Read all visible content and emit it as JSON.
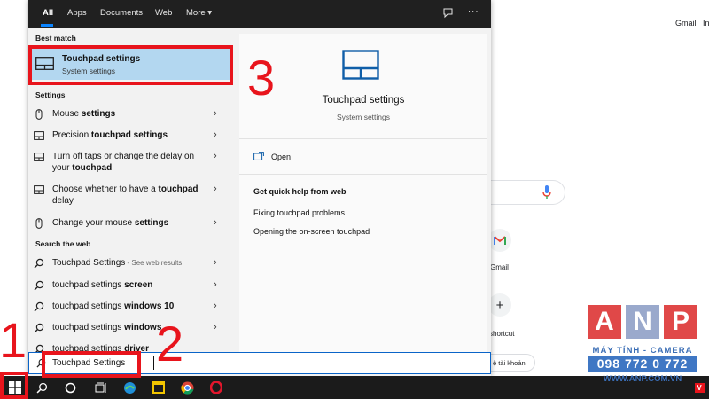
{
  "background": {
    "gmail": "Gmail",
    "images_partial": "In",
    "tile_gmail_label": "Gmail",
    "tile_add_label": "shortcut",
    "account_pill": "ệ tài khoản"
  },
  "search_panel": {
    "tabs": [
      {
        "label": "All",
        "active": true
      },
      {
        "label": "Apps",
        "active": false
      },
      {
        "label": "Documents",
        "active": false
      },
      {
        "label": "Web",
        "active": false
      },
      {
        "label": "More",
        "active": false
      }
    ],
    "more_caret": "▾",
    "feedback_icon": "feedback-icon",
    "overflow": "···",
    "best_match_header": "Best match",
    "best_match": {
      "title": "Touchpad settings",
      "subtitle": "System settings"
    },
    "settings_header": "Settings",
    "settings_items": [
      {
        "pre": "Mouse ",
        "bold": "settings",
        "post": ""
      },
      {
        "pre": "Precision ",
        "bold": "touchpad settings",
        "post": ""
      },
      {
        "pre": "Turn off taps or change the delay on your ",
        "bold": "touchpad",
        "post": ""
      },
      {
        "pre": "Choose whether to have a ",
        "bold": "touchpad",
        "post": " delay"
      },
      {
        "pre": "Change your mouse ",
        "bold": "settings",
        "post": ""
      }
    ],
    "web_header": "Search the web",
    "web_items": [
      {
        "pre": "Touchpad Settings",
        "bold": "",
        "muted": " - See web results"
      },
      {
        "pre": "touchpad settings ",
        "bold": "screen",
        "muted": ""
      },
      {
        "pre": "touchpad settings ",
        "bold": "windows 10",
        "muted": ""
      },
      {
        "pre": "touchpad settings ",
        "bold": "windows",
        "muted": ""
      },
      {
        "pre": "touchpad settings ",
        "bold": "driver",
        "muted": ""
      }
    ],
    "preview": {
      "title": "Touchpad settings",
      "subtitle": "System settings",
      "open_label": "Open",
      "help_header": "Get quick help from web",
      "help_links": [
        "Fixing touchpad problems",
        "Opening the on-screen touchpad"
      ]
    },
    "query": "Touchpad Settings"
  },
  "annotations": {
    "n1": "1",
    "n2": "2",
    "n3": "3",
    "color": "#e8141c"
  },
  "watermark": {
    "letters": [
      "A",
      "N",
      "P"
    ],
    "letter_colors": [
      "#e04848",
      "#9aa9cc",
      "#e04848"
    ],
    "line1": "MÁY TÍNH - CAMERA",
    "line2": "098 772 0 772",
    "line3": "WWW.ANP.COM.VN"
  },
  "colors": {
    "accent": "#0a84ff",
    "selected": "#b3d7f0",
    "taskbar": "#1b1b1b"
  }
}
